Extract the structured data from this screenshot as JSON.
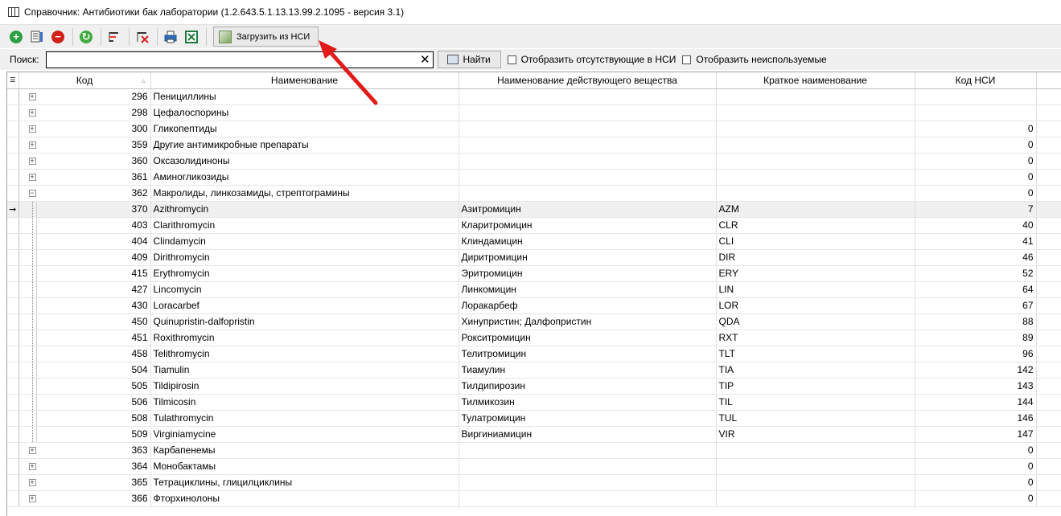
{
  "window": {
    "title": "Справочник: Антибиотики бак лаборатории (1.2.643.5.1.13.13.99.2.1095 - версия 3.1)"
  },
  "toolbar": {
    "icons": [
      "add-icon",
      "edit-icon",
      "delete-icon",
      "refresh-icon",
      "filter-icon",
      "clear-filter-icon",
      "print-icon",
      "excel-icon"
    ],
    "load_nsi_label": "Загрузить из НСИ"
  },
  "search": {
    "label": "Поиск:",
    "value": "",
    "clear_glyph": "✕",
    "find_label": "Найти",
    "show_missing_label": "Отобразить отсутствующие в НСИ",
    "show_unused_label": "Отобразить неиспользуемые",
    "show_missing_checked": false,
    "show_unused_checked": false
  },
  "grid": {
    "columns": {
      "code": "Код",
      "name": "Наименование",
      "substance": "Наименование действующего вещества",
      "short": "Краткое наименование",
      "nsi": "Код НСИ"
    },
    "rows": [
      {
        "type": "group",
        "expander": "+",
        "code": "296",
        "name": "Пенициллины",
        "substance": "",
        "short": "",
        "nsi": ""
      },
      {
        "type": "group",
        "expander": "+",
        "code": "298",
        "name": "Цефалоспорины",
        "substance": "",
        "short": "",
        "nsi": ""
      },
      {
        "type": "group",
        "expander": "+",
        "code": "300",
        "name": "Гликопептиды",
        "substance": "",
        "short": "",
        "nsi": "0"
      },
      {
        "type": "group",
        "expander": "+",
        "code": "359",
        "name": "Другие антимикробные препараты",
        "substance": "",
        "short": "",
        "nsi": "0"
      },
      {
        "type": "group",
        "expander": "+",
        "code": "360",
        "name": "Оксазолидиноны",
        "substance": "",
        "short": "",
        "nsi": "0"
      },
      {
        "type": "group",
        "expander": "+",
        "code": "361",
        "name": "Аминогликозиды",
        "substance": "",
        "short": "",
        "nsi": "0"
      },
      {
        "type": "group",
        "expander": "−",
        "code": "362",
        "name": "Макролиды, линкозамиды, стрептограмины",
        "substance": "",
        "short": "",
        "nsi": "0"
      },
      {
        "type": "child",
        "current": true,
        "code": "370",
        "name": "Azithromycin",
        "substance": "Азитромицин",
        "short": "AZM",
        "nsi": "7"
      },
      {
        "type": "child",
        "code": "403",
        "name": "Clarithromycin",
        "substance": "Кларитромицин",
        "short": "CLR",
        "nsi": "40"
      },
      {
        "type": "child",
        "code": "404",
        "name": "Clindamycin",
        "substance": "Клиндамицин",
        "short": "CLI",
        "nsi": "41"
      },
      {
        "type": "child",
        "code": "409",
        "name": "Dirithromycin",
        "substance": "Диритромицин",
        "short": "DIR",
        "nsi": "46"
      },
      {
        "type": "child",
        "code": "415",
        "name": "Erythromycin",
        "substance": "Эритромицин",
        "short": "ERY",
        "nsi": "52"
      },
      {
        "type": "child",
        "code": "427",
        "name": "Lincomycin",
        "substance": "Линкомицин",
        "short": "LIN",
        "nsi": "64"
      },
      {
        "type": "child",
        "code": "430",
        "name": "Loracarbef",
        "substance": "Лоракарбеф",
        "short": "LOR",
        "nsi": "67"
      },
      {
        "type": "child",
        "code": "450",
        "name": "Quinupristin-dalfopristin",
        "substance": "Хинупристин; Далфопристин",
        "short": "QDA",
        "nsi": "88"
      },
      {
        "type": "child",
        "code": "451",
        "name": "Roxithromycin",
        "substance": "Рокситромицин",
        "short": "RXT",
        "nsi": "89"
      },
      {
        "type": "child",
        "code": "458",
        "name": "Telithromycin",
        "substance": "Телитромицин",
        "short": "TLT",
        "nsi": "96"
      },
      {
        "type": "child",
        "code": "504",
        "name": "Tiamulin",
        "substance": "Тиамулин",
        "short": "TIA",
        "nsi": "142"
      },
      {
        "type": "child",
        "code": "505",
        "name": "Tildipirosin",
        "substance": "Тилдипирозин",
        "short": "TIP",
        "nsi": "143"
      },
      {
        "type": "child",
        "code": "506",
        "name": "Tilmicosin",
        "substance": "Тилмикозин",
        "short": "TIL",
        "nsi": "144"
      },
      {
        "type": "child",
        "code": "508",
        "name": "Tulathromycin",
        "substance": "Тулатромицин",
        "short": "TUL",
        "nsi": "146"
      },
      {
        "type": "child",
        "code": "509",
        "name": "Virginiamycine",
        "substance": "Виргиниамицин",
        "short": "VIR",
        "nsi": "147"
      },
      {
        "type": "group",
        "expander": "+",
        "code": "363",
        "name": "Карбапенемы",
        "substance": "",
        "short": "",
        "nsi": "0"
      },
      {
        "type": "group",
        "expander": "+",
        "code": "364",
        "name": "Монобактамы",
        "substance": "",
        "short": "",
        "nsi": "0"
      },
      {
        "type": "group",
        "expander": "+",
        "code": "365",
        "name": "Тетрациклины, глицилциклины",
        "substance": "",
        "short": "",
        "nsi": "0"
      },
      {
        "type": "group",
        "expander": "+",
        "code": "366",
        "name": "Фторхинолоны",
        "substance": "",
        "short": "",
        "nsi": "0"
      }
    ]
  },
  "annotation": {
    "arrow_color": "#e11a1a"
  }
}
